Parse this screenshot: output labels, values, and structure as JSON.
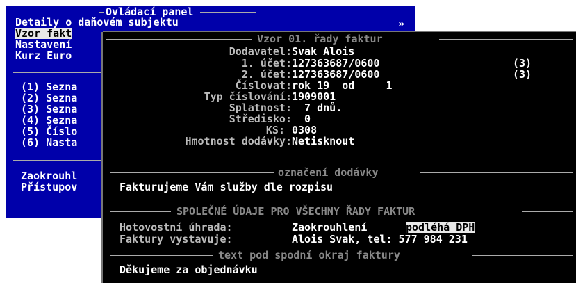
{
  "control_panel": {
    "title": "Ovládací panel",
    "items_top": [
      "Detaily o daňovém subjektu",
      "Vzor fakt",
      "Nastavení",
      "Kurz Euro"
    ],
    "more_arrow": "»",
    "numbered": [
      "(1) Sezna",
      "(2) Sezna",
      "(3) Sezna",
      "(4) Sezna",
      "(5) Číslo",
      "(6) Nasta"
    ],
    "bottom": [
      "Zaokrouhl",
      "Přístupov"
    ]
  },
  "invoice_template": {
    "title": "Vzor 01. řady faktur",
    "fields": [
      {
        "label": "Dodavatel:",
        "value": "Svak Alois",
        "extra": ""
      },
      {
        "label": "1. účet:",
        "value": "127363687/0600",
        "extra": "(3)"
      },
      {
        "label": "2. účet:",
        "value": "127363687/0600",
        "extra": "(3)"
      },
      {
        "label": "Číslovat:",
        "value": "rok 19  od     1",
        "extra": ""
      },
      {
        "label": "Typ číslování:",
        "value": "1909001",
        "extra": ""
      },
      {
        "label": "Splatnost:",
        "value": "  7 dnů.",
        "extra": ""
      },
      {
        "label": "Středisko:",
        "value": "  0",
        "extra": ""
      },
      {
        "label": "KS:",
        "value": "0308",
        "extra": ""
      },
      {
        "label": "Hmotnost dodávky:",
        "value": "Netisknout",
        "extra": ""
      }
    ],
    "delivery_section_title": "označení dodávky",
    "delivery_text": "Fakturujeme Vám služby dle rozpisu",
    "common_section_title": "SPOLEČNÉ ÚDAJE PRO VŠECHNY ŘADY FAKTUR",
    "cash_label": "Hotovostní úhrada:",
    "cash_value": "Zaokrouhlení",
    "cash_selected": "podléhá DPH",
    "issuer_label": "Faktury vystavuje:",
    "issuer_value": "Alois Svak, tel: 577 984 231",
    "footer_section_title": "text pod spodní okraj faktury",
    "footer_text": "Děkujeme za objednávku"
  }
}
